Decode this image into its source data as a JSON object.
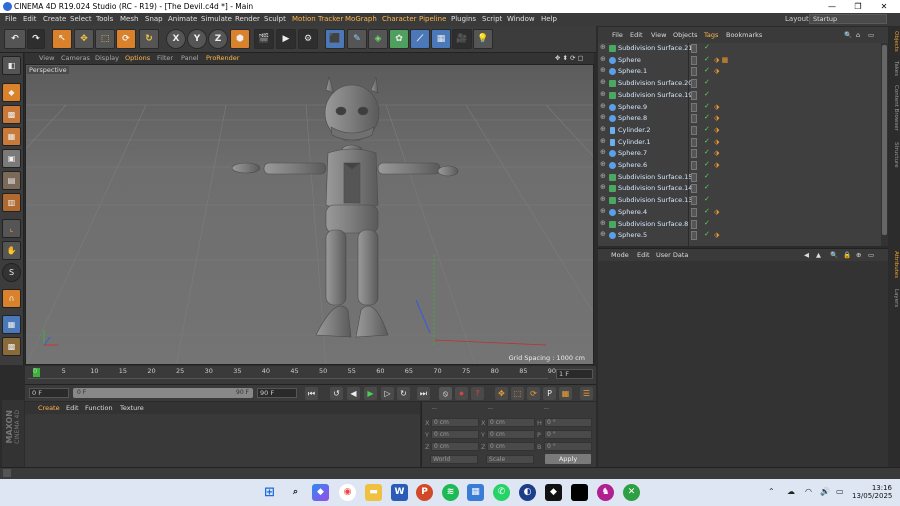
{
  "window": {
    "title": "CINEMA 4D R19.024 Studio (RC - R19) - [The Devil.c4d *] - Main",
    "minimize": "—",
    "maximize": "❐",
    "close": "✕"
  },
  "menubar": {
    "items": [
      "File",
      "Edit",
      "Create",
      "Select",
      "Tools",
      "Mesh",
      "Snap",
      "Animate",
      "Simulate",
      "Render",
      "Sculpt",
      "Motion Tracker",
      "MoGraph",
      "Character",
      "Pipeline",
      "Plugins",
      "Script",
      "Window",
      "Help"
    ],
    "layout_label": "Layout:",
    "layout_value": "Startup"
  },
  "toolbar": {
    "axis_x": "X",
    "axis_y": "Y",
    "axis_z": "Z"
  },
  "viewport": {
    "menu": [
      "View",
      "Cameras",
      "Display",
      "Options",
      "Filter",
      "Panel",
      "ProRender"
    ],
    "camera_label": "Perspective",
    "grid_spacing": "Grid Spacing : 1000 cm"
  },
  "timeline": {
    "ticks": [
      "0",
      "5",
      "10",
      "15",
      "20",
      "25",
      "30",
      "35",
      "40",
      "45",
      "50",
      "55",
      "60",
      "65",
      "70",
      "75",
      "80",
      "85",
      "90"
    ],
    "current_frame_display": "1 F"
  },
  "playback": {
    "start_frame": "0 F",
    "min_frame": "0 F",
    "max_frame": "90 F",
    "end_frame": "90 F"
  },
  "material_manager": {
    "menu": [
      "Create",
      "Edit",
      "Function",
      "Texture"
    ],
    "brand_line1": "MAXON",
    "brand_line2": "CINEMA 4D"
  },
  "coordinates": {
    "header": [
      "--",
      "--",
      "--"
    ],
    "rows": [
      {
        "axis": "X",
        "pos": "0 cm",
        "size_axis": "X",
        "size": "0 cm",
        "rot_axis": "H",
        "rot": "0 °"
      },
      {
        "axis": "Y",
        "pos": "0 cm",
        "size_axis": "Y",
        "size": "0 cm",
        "rot_axis": "P",
        "rot": "0 °"
      },
      {
        "axis": "Z",
        "pos": "0 cm",
        "size_axis": "Z",
        "size": "0 cm",
        "rot_axis": "B",
        "rot": "0 °"
      }
    ],
    "mode_select": "World",
    "scale_select": "Scale",
    "apply_label": "Apply"
  },
  "object_manager": {
    "menu": [
      "File",
      "Edit",
      "View",
      "Objects",
      "Tags",
      "Bookmarks"
    ],
    "objects": [
      {
        "name": "Subdivision Surface.21",
        "type": "sub",
        "tags": ""
      },
      {
        "name": "Sphere",
        "type": "sphere",
        "tags": "⬗ ▦"
      },
      {
        "name": "Sphere.1",
        "type": "sphere",
        "tags": "⬗"
      },
      {
        "name": "Subdivision Surface.20",
        "type": "sub",
        "tags": ""
      },
      {
        "name": "Subdivision Surface.19",
        "type": "sub",
        "tags": ""
      },
      {
        "name": "Sphere.9",
        "type": "sphere",
        "tags": "⬗"
      },
      {
        "name": "Sphere.8",
        "type": "sphere",
        "tags": "⬗"
      },
      {
        "name": "Cylinder.2",
        "type": "cyl",
        "tags": "⬗"
      },
      {
        "name": "Cylinder.1",
        "type": "cyl",
        "tags": "⬗"
      },
      {
        "name": "Sphere.7",
        "type": "sphere",
        "tags": "⬗"
      },
      {
        "name": "Sphere.6",
        "type": "sphere",
        "tags": "⬗"
      },
      {
        "name": "Subdivision Surface.15",
        "type": "sub",
        "tags": ""
      },
      {
        "name": "Subdivision Surface.14",
        "type": "sub",
        "tags": ""
      },
      {
        "name": "Subdivision Surface.13",
        "type": "sub",
        "tags": ""
      },
      {
        "name": "Sphere.4",
        "type": "sphere",
        "tags": "⬗"
      },
      {
        "name": "Subdivision Surface.8",
        "type": "sub",
        "tags": ""
      },
      {
        "name": "Sphere.5",
        "type": "sphere",
        "tags": "⬗"
      }
    ]
  },
  "attribute_manager": {
    "menu": [
      "Mode",
      "Edit",
      "User Data"
    ]
  },
  "side_tabs": [
    "Objects",
    "Takes",
    "Content Browser",
    "Structure",
    "Attributes",
    "Layers"
  ],
  "taskbar": {
    "time": "13:16",
    "date": "13/05/2025"
  }
}
